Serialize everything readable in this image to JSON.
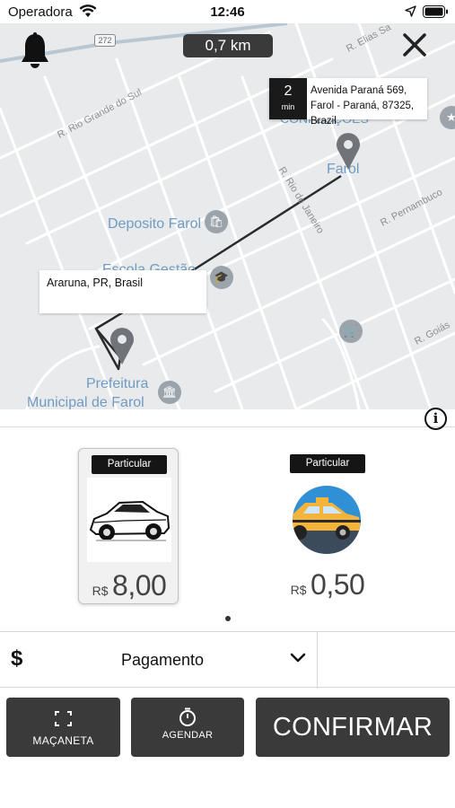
{
  "status_bar": {
    "carrier": "Operadora",
    "time": "12:46",
    "icons": [
      "wifi-icon",
      "location-arrow-icon",
      "battery-icon"
    ]
  },
  "map": {
    "distance": "0,7 km",
    "destination": {
      "eta_value": "2",
      "eta_unit": "min",
      "address": "Avenida Paraná 569, Farol - Paraná, 87325, Brazil"
    },
    "origin": {
      "address": "Araruna, PR, Brasil"
    },
    "streets": [
      "R. Rio Grande do Sul",
      "R. Rio de Janeiro",
      "R. Pernambuco",
      "R. Goiás",
      "R. Elias Sa"
    ],
    "road_shield": "272",
    "places": {
      "farol": "Farol",
      "deposito": "Deposito Farol",
      "prefeitura_line1": "Prefeitura",
      "prefeitura_line2": "Municipal de Farol",
      "confeccoes": "CONFECÇÕES",
      "escola": "Escola Gestão"
    },
    "icons": [
      "bell-icon",
      "close-icon",
      "map-pin-icon",
      "info-icon"
    ]
  },
  "vehicles": [
    {
      "category": "Particular",
      "currency": "R$",
      "price": "8,00",
      "image": "sedan-car",
      "selected": true
    },
    {
      "category": "Particular",
      "currency": "R$",
      "price": "0,50",
      "image": "taxi-car",
      "selected": false
    }
  ],
  "payment": {
    "icon": "dollar-icon",
    "label": "Pagamento"
  },
  "buttons": {
    "macaneta": "MAÇANETA",
    "agendar": "AGENDAR",
    "confirmar": "CONFIRMAR"
  },
  "colors": {
    "map_background": "#e9eaeb",
    "dark_button": "#3a3a3a",
    "poi_text": "#6f9cc3",
    "taxi_circle": "#2f90d6",
    "taxi_body": "#f4b43c"
  }
}
